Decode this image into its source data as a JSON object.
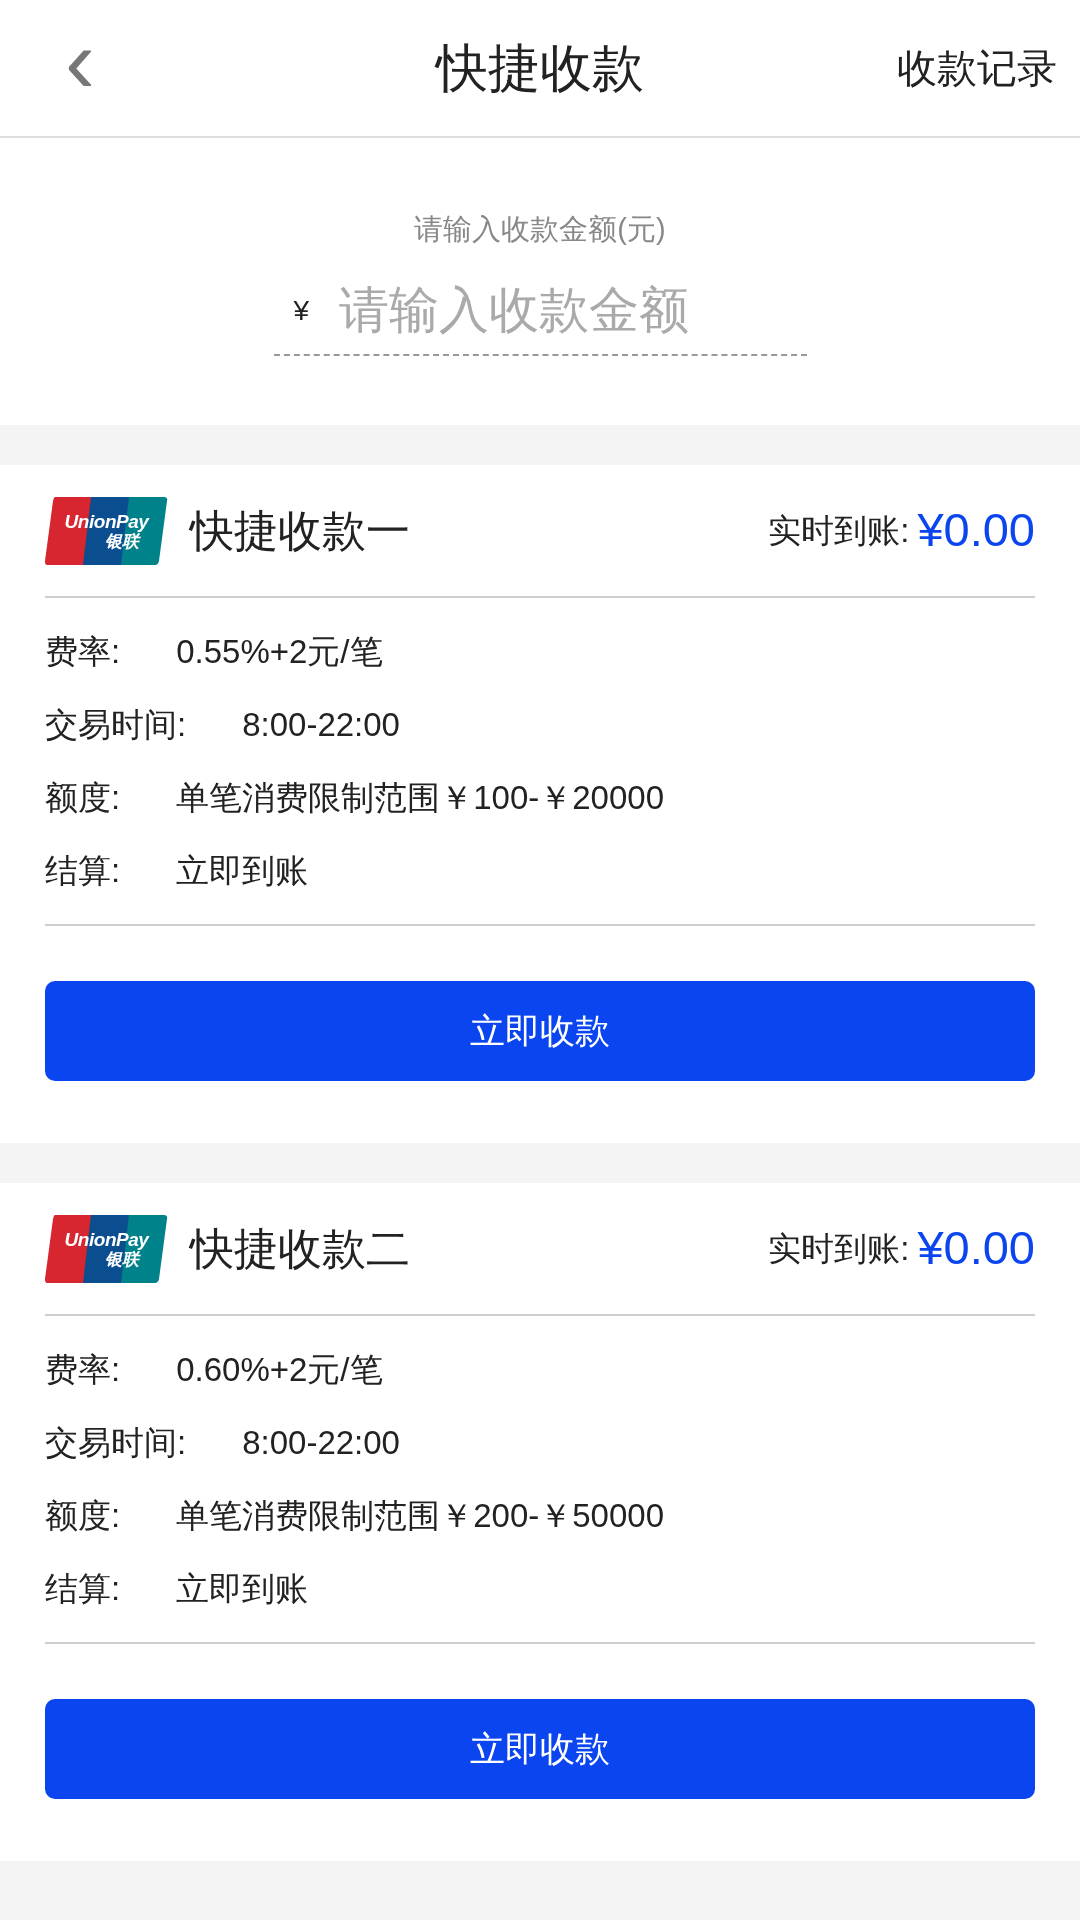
{
  "header": {
    "back_icon": "‹",
    "title": "快捷收款",
    "action": "收款记录"
  },
  "amount": {
    "label": "请输入收款金额(元)",
    "currency": "¥",
    "placeholder": "请输入收款金额"
  },
  "channels": [
    {
      "logo": {
        "top": "UnionPay",
        "bottom": "银联"
      },
      "name": "快捷收款一",
      "arrival_label": "实时到账:",
      "arrival_amount": "¥0.00",
      "details": [
        {
          "label": "费率:",
          "value": "0.55%+2元/笔"
        },
        {
          "label": "交易时间:",
          "value": "8:00-22:00"
        },
        {
          "label": "额度:",
          "value": "单笔消费限制范围￥100-￥20000"
        },
        {
          "label": "结算:",
          "value": "立即到账"
        }
      ],
      "button": "立即收款"
    },
    {
      "logo": {
        "top": "UnionPay",
        "bottom": "银联"
      },
      "name": "快捷收款二",
      "arrival_label": "实时到账:",
      "arrival_amount": "¥0.00",
      "details": [
        {
          "label": "费率:",
          "value": "0.60%+2元/笔"
        },
        {
          "label": "交易时间:",
          "value": "8:00-22:00"
        },
        {
          "label": "额度:",
          "value": "单笔消费限制范围￥200-￥50000"
        },
        {
          "label": "结算:",
          "value": "立即到账"
        }
      ],
      "button": "立即收款"
    }
  ]
}
